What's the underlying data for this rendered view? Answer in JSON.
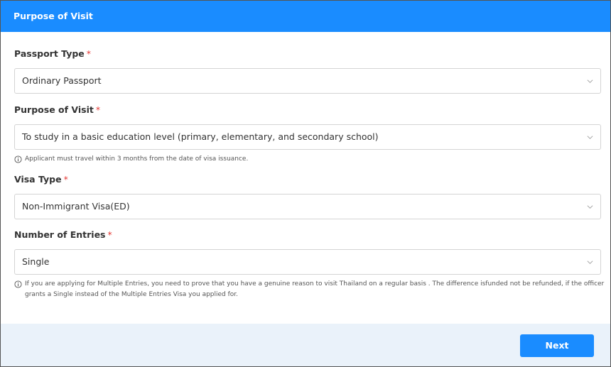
{
  "header": {
    "title": "Purpose of Visit"
  },
  "form": {
    "passport_type": {
      "label": "Passport Type",
      "required_mark": "*",
      "value": "Ordinary Passport",
      "icon": "chevron-down-icon"
    },
    "purpose_of_visit": {
      "label": "Purpose of Visit",
      "required_mark": "*",
      "value": "To study in a basic education level (primary, elementary, and secondary school)",
      "icon": "chevron-down-icon",
      "note": "Applicant must travel within 3 months from the date of visa issuance.",
      "note_icon": "info-icon"
    },
    "visa_type": {
      "label": "Visa Type",
      "required_mark": "*",
      "value": "Non-Immigrant Visa(ED)",
      "icon": "chevron-down-icon"
    },
    "number_of_entries": {
      "label": "Number of Entries",
      "required_mark": "*",
      "value": "Single",
      "icon": "chevron-down-icon",
      "note": "If you are applying for Multiple Entries, you need to prove that you have a genuine reason to visit Thailand on a regular basis . The difference isfunded not be refunded, if the officer grants a Single instead of the Multiple Entries Visa you applied for.",
      "note_icon": "info-icon"
    }
  },
  "footer": {
    "next_label": "Next"
  },
  "colors": {
    "accent": "#1a8cff",
    "required": "#e53935",
    "footer_bg": "#eaf2fa",
    "border": "#d4d4d4"
  }
}
